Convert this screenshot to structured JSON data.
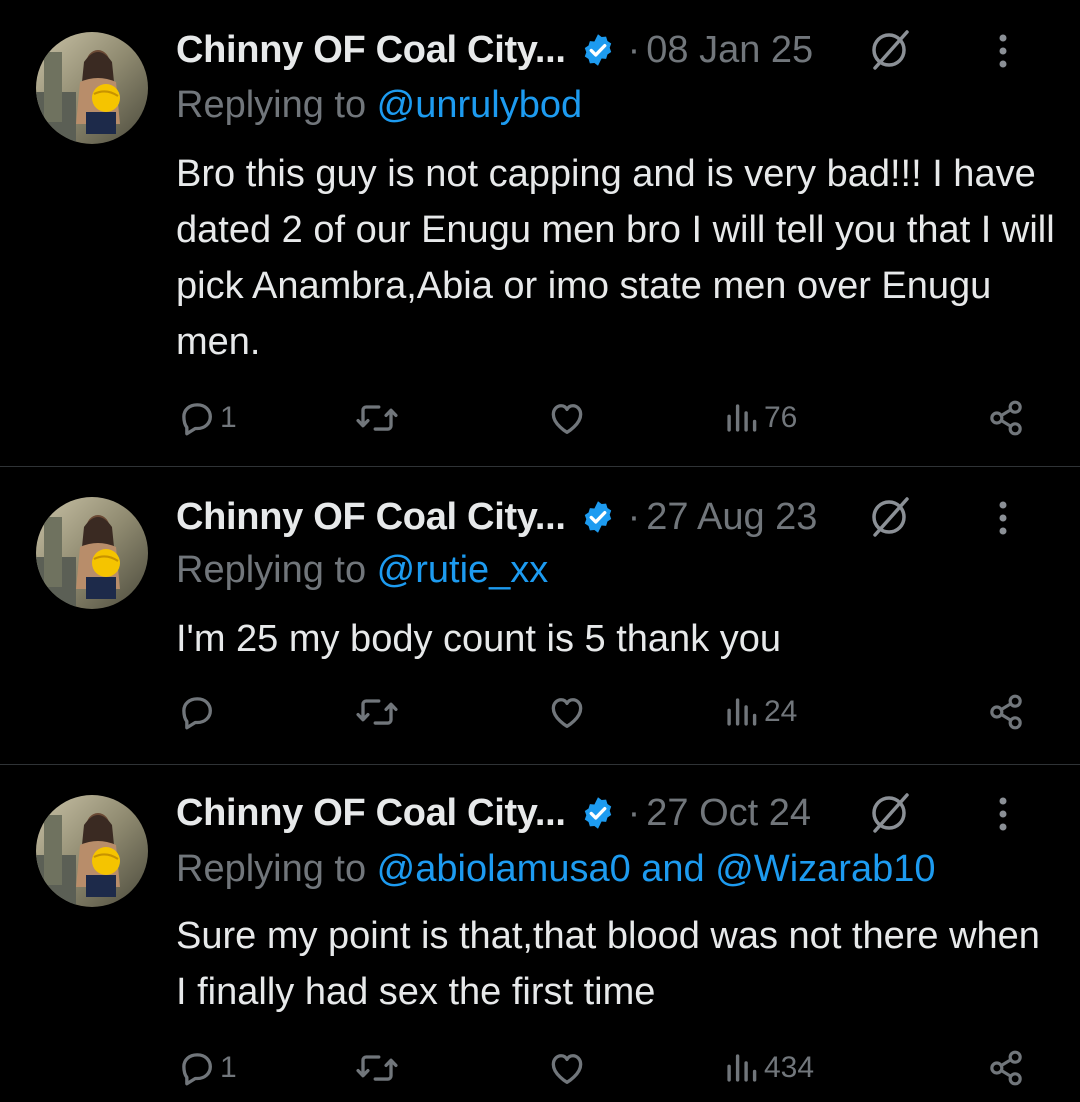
{
  "colors": {
    "background": "#000000",
    "text": "#e7e9ea",
    "muted": "#71767b",
    "link": "#1d9bf0",
    "verified_badge": "#1d9bf0",
    "divider": "#2f3336"
  },
  "tweets": [
    {
      "author_name": "Chinny OF Coal City...",
      "verified": true,
      "separator": "·",
      "date": "08 Jan 25",
      "replying_prefix": "Replying to ",
      "replying_to": "@unrulybod",
      "replying_joiner": "",
      "replying_to_2": "",
      "text": "Bro this guy is not capping and is very bad!!! I have dated 2 of our Enugu men bro I will tell you that I will pick Anambra,Abia or imo state men over Enugu men.",
      "reply_count": "1",
      "retweet_count": "",
      "like_count": "",
      "views": "76",
      "icons": [
        "grok-icon",
        "more-icon",
        "reply-icon",
        "retweet-icon",
        "like-icon",
        "views-icon",
        "share-icon"
      ]
    },
    {
      "author_name": "Chinny OF Coal City...",
      "verified": true,
      "separator": "·",
      "date": "27 Aug 23",
      "replying_prefix": "Replying to ",
      "replying_to": "@rutie_xx",
      "replying_joiner": "",
      "replying_to_2": "",
      "text": "I'm 25 my body count is 5 thank you",
      "reply_count": "",
      "retweet_count": "",
      "like_count": "",
      "views": "24",
      "icons": [
        "grok-icon",
        "more-icon",
        "reply-icon",
        "retweet-icon",
        "like-icon",
        "views-icon",
        "share-icon"
      ]
    },
    {
      "author_name": "Chinny OF Coal City...",
      "verified": true,
      "separator": "·",
      "date": "27 Oct 24",
      "replying_prefix": "Replying to ",
      "replying_to": "@abiolamusa0",
      "replying_joiner": " and ",
      "replying_to_2": "@Wizarab10",
      "text": "Sure my point is that,that blood was not there when I finally had sex the first time",
      "reply_count": "1",
      "retweet_count": "",
      "like_count": "",
      "views": "434",
      "icons": [
        "grok-icon",
        "more-icon",
        "reply-icon",
        "retweet-icon",
        "like-icon",
        "views-icon",
        "share-icon"
      ]
    }
  ]
}
